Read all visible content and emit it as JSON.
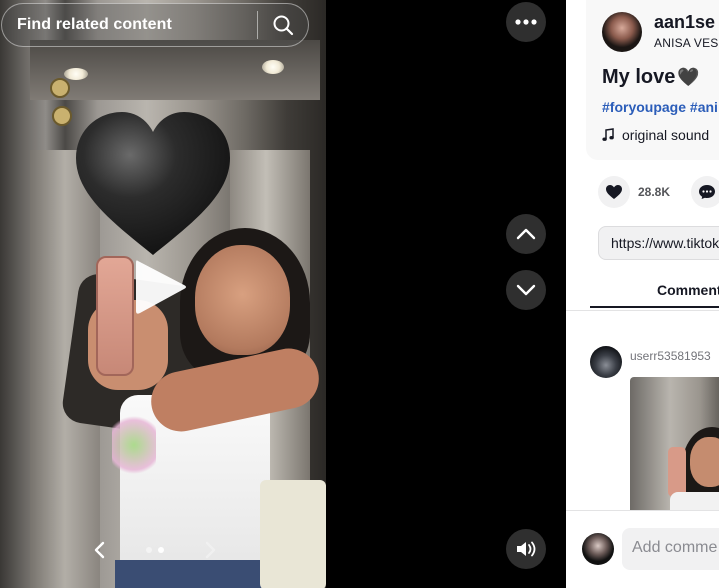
{
  "search": {
    "placeholder": "Find related content"
  },
  "player": {
    "carousel": {
      "total": 2,
      "active_index": 1
    }
  },
  "post": {
    "username": "aan1se",
    "nickname": "ANISA VES",
    "caption": "My love",
    "caption_emoji": "🖤",
    "hashtags": "#foryoupage #ani",
    "music": "original sound",
    "likes": "28.8K",
    "link": "https://www.tiktok"
  },
  "tabs": {
    "comments_label": "Comment"
  },
  "comments": [
    {
      "username": "userr53581953"
    }
  ],
  "composer": {
    "placeholder": "Add comme"
  },
  "colors": {
    "hashtag": "#2b5db9",
    "text": "#161823",
    "control_bg": "#2f2f2f"
  },
  "icons": [
    "search-icon",
    "play-icon",
    "more-icon",
    "chevron-up-icon",
    "chevron-down-icon",
    "volume-icon",
    "heart-icon",
    "comment-icon",
    "music-note-icon",
    "chevron-left-icon",
    "chevron-right-icon"
  ]
}
